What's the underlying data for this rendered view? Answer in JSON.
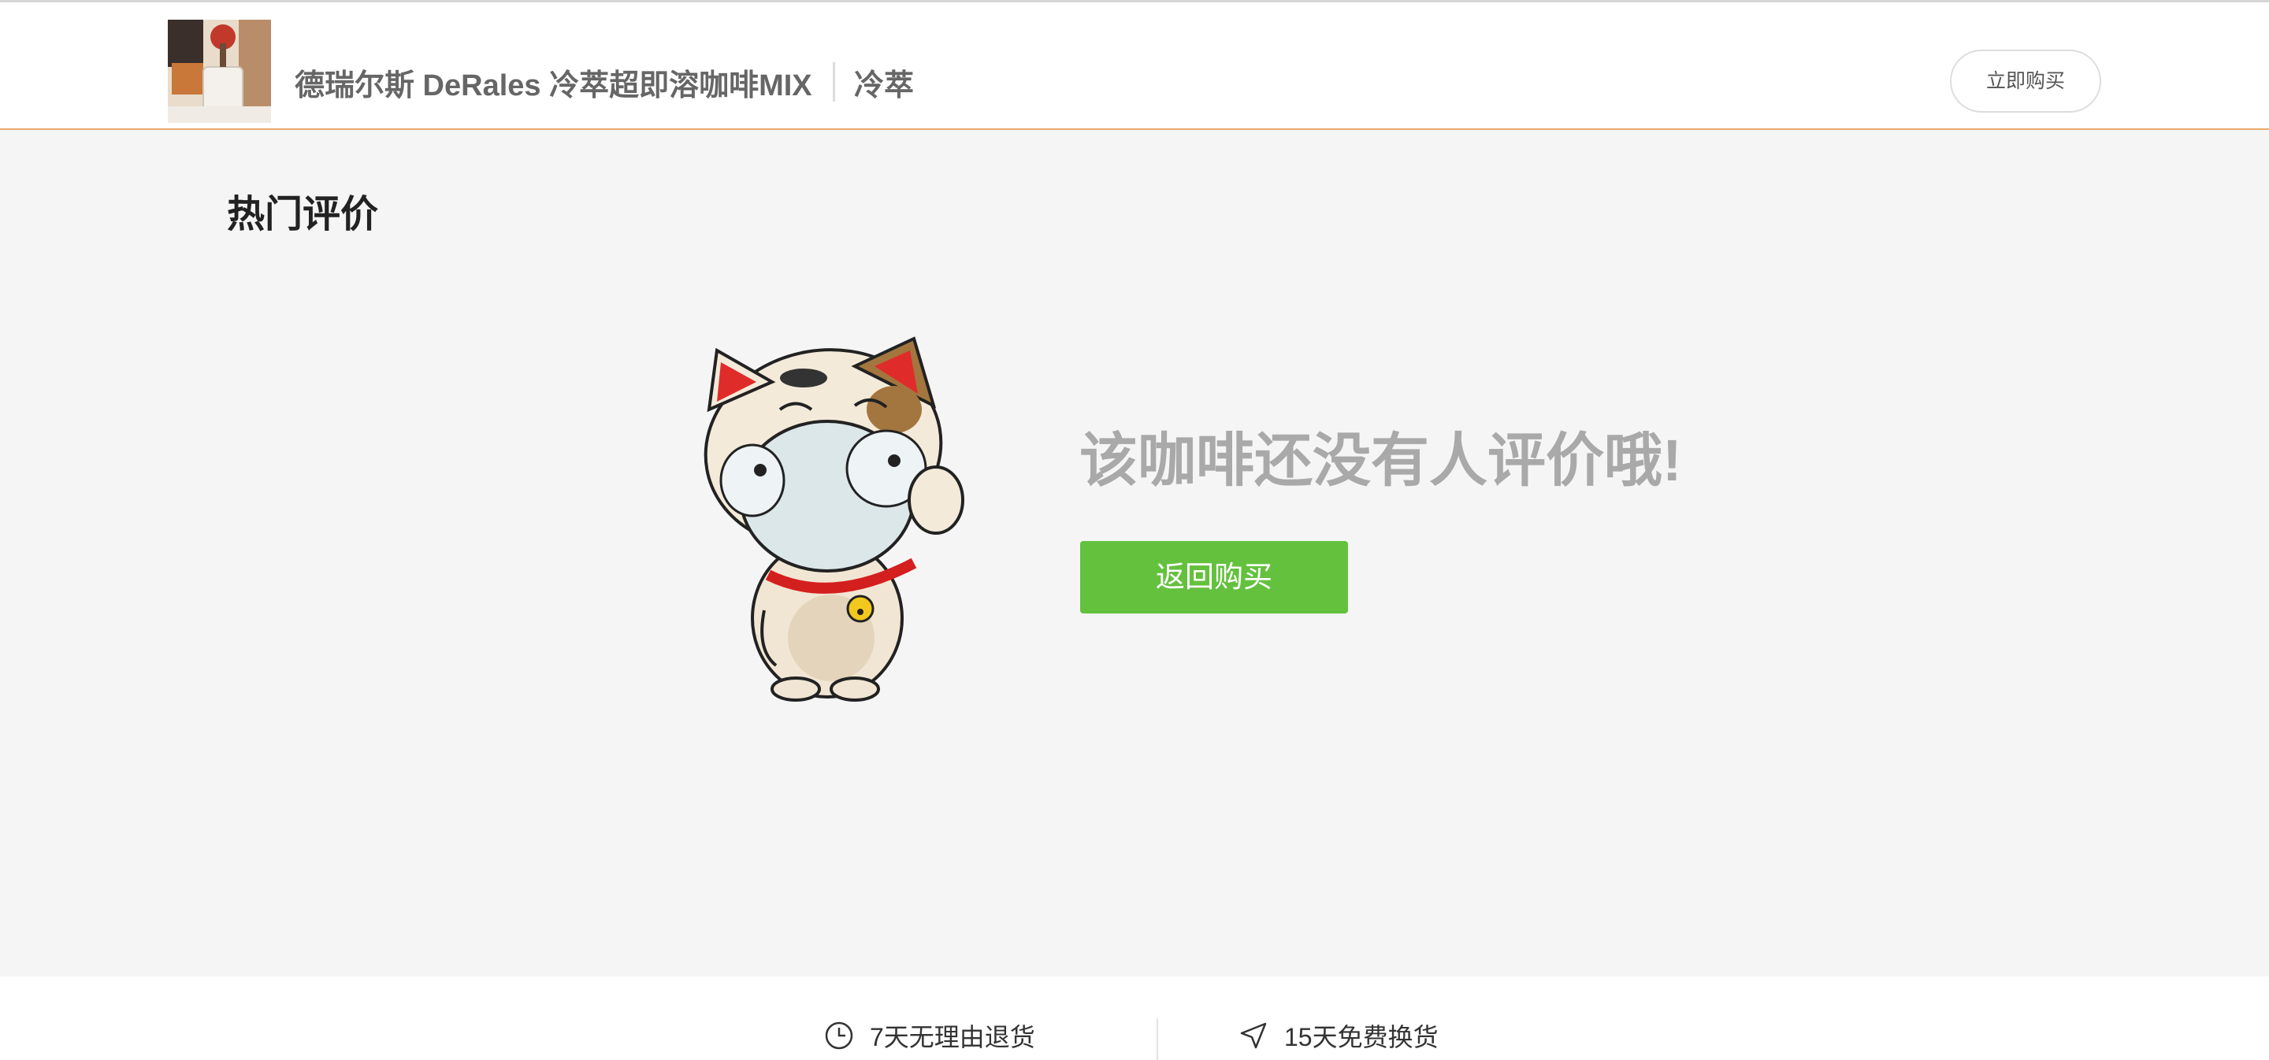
{
  "header": {
    "product_name": "德瑞尔斯 DeRales 冷萃超即溶咖啡MIX",
    "product_variant": "冷萃",
    "buy_now_label": "立即购买"
  },
  "reviews": {
    "section_title": "热门评价",
    "empty_message": "该咖啡还没有人评价哦!",
    "back_button_label": "返回购买"
  },
  "footer": {
    "services": [
      {
        "icon": "clock-icon",
        "label": "7天无理由退货"
      },
      {
        "icon": "send-arrow-icon",
        "label": "15天免费换货"
      }
    ]
  },
  "colors": {
    "accent_green": "#64c13e",
    "header_border": "#e8a86a",
    "background": "#f5f5f5"
  }
}
